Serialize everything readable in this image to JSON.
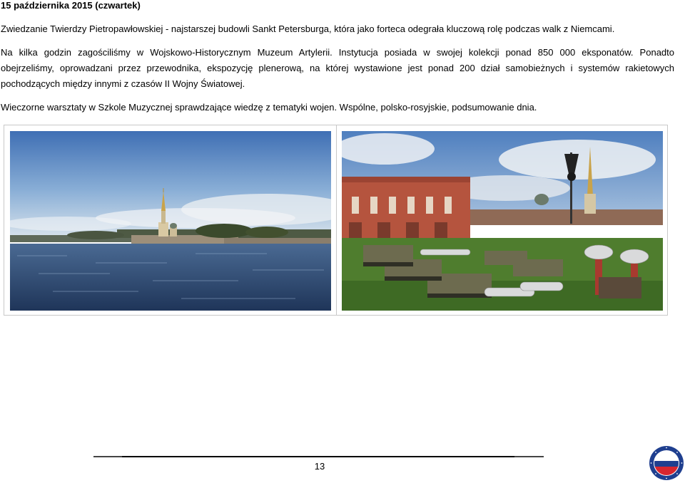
{
  "heading": "15 października 2015 (czwartek)",
  "paragraphs": {
    "p1": "Zwiedzanie Twierdzy Pietropawłowskiej - najstarszej budowli Sankt Petersburga, która jako forteca odegrała kluczową rolę podczas walk z Niemcami.",
    "p2_line1": "Na kilka godzin zagościliśmy w Wojskowo-Historycznym Muzeum Artylerii. Instytucja posiada w swojej kolekcji ponad 850 000 eksponatów. Ponadto",
    "p2_line2": "obejrzeliśmy, oprowadzani przez przewodnika, ekspozycję plenerową, na której wystawione jest ponad 200 dział samobieżnych i systemów rakietowych",
    "p2_line3": "pochodzących między innymi z czasów II Wojny Światowej.",
    "p3": "Wieczorne warsztaty w Szkole Muzycznej sprawdzające wiedzę z tematyki wojen. Wspólne, polsko-rosyjskie, podsumowanie dnia."
  },
  "page_number": "13",
  "colors": {
    "logo_blue": "#1f3f8f",
    "logo_red": "#d8262e",
    "rule": "#444444"
  }
}
